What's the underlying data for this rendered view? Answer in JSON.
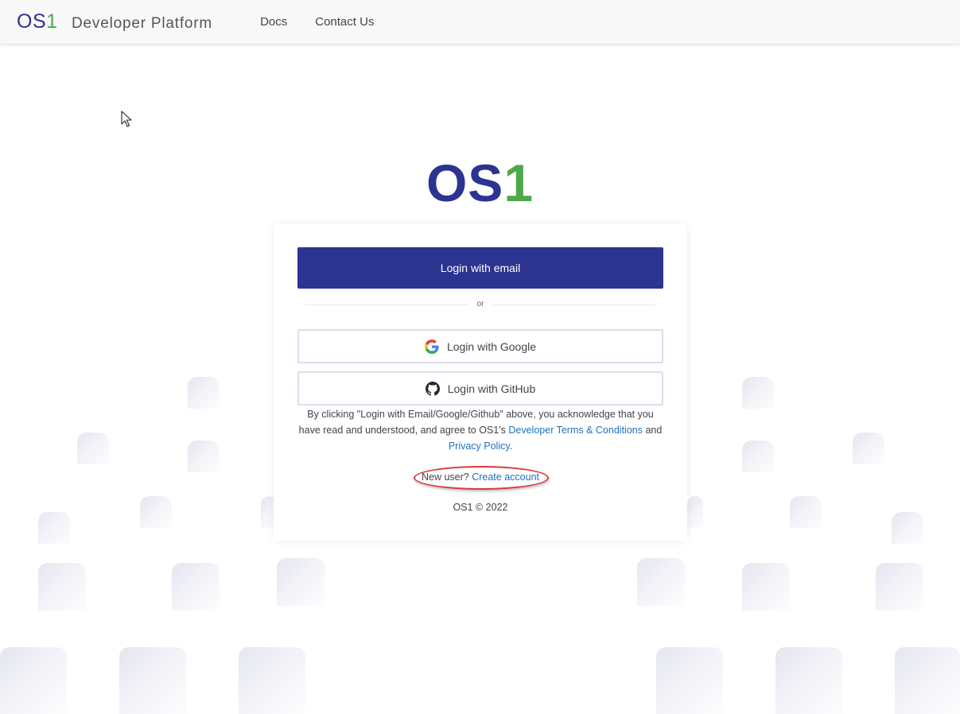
{
  "header": {
    "brand_os": "OS",
    "brand_one": "1",
    "brand_subtitle": "Developer Platform",
    "nav": [
      {
        "label": "Docs"
      },
      {
        "label": "Contact Us"
      }
    ]
  },
  "hero": {
    "logo_os": "OS",
    "logo_one": "1"
  },
  "login": {
    "email_button": "Login with email",
    "divider_text": "or",
    "google_button": "Login with Google",
    "github_button": "Login with GitHub",
    "terms_prefix": "By clicking \"Login with Email/Google/Github\" above, you acknowledge that you have read and understood, and agree to OS1's",
    "terms_link": "Developer Terms & Conditions",
    "terms_and": "and",
    "privacy_link": "Privacy Policy",
    "terms_suffix": ".",
    "new_user_text": "New user?",
    "create_account_link": "Create account",
    "copyright": "OS1 © 2022"
  },
  "colors": {
    "brand_blue": "#2b3491",
    "brand_green": "#4ea84b",
    "link_blue": "#1e73be",
    "highlight_red": "#d93a3a"
  },
  "icons": [
    "google-icon",
    "github-icon",
    "mouse-cursor-icon"
  ]
}
